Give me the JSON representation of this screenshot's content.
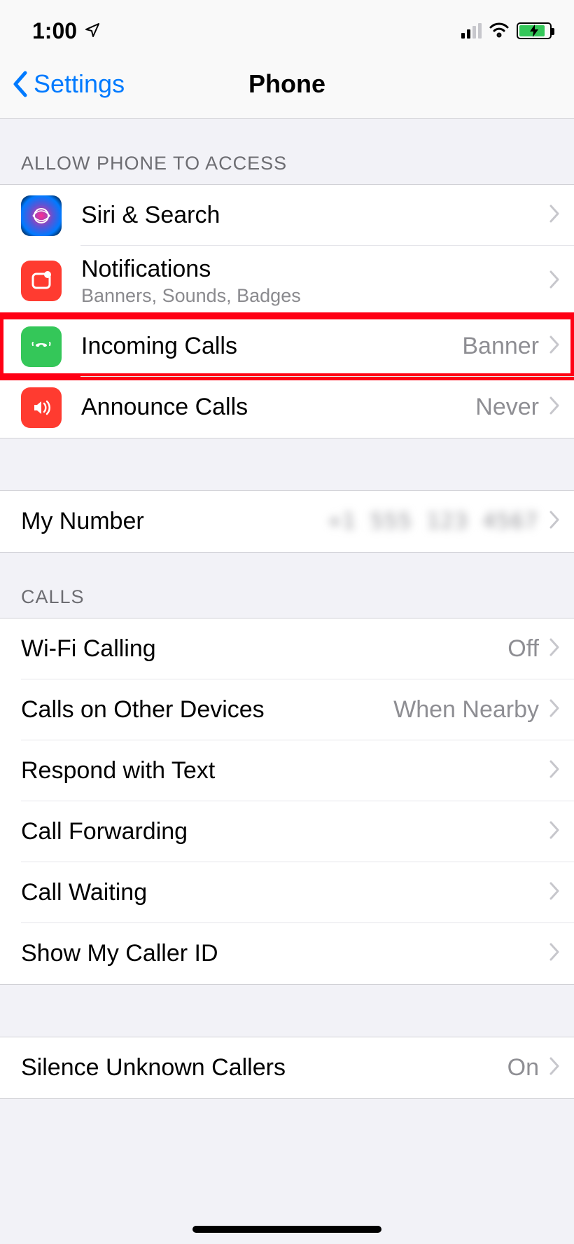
{
  "status": {
    "time": "1:00"
  },
  "nav": {
    "back": "Settings",
    "title": "Phone"
  },
  "section_access_header": "ALLOW PHONE TO ACCESS",
  "access": {
    "siri": {
      "title": "Siri & Search"
    },
    "notif": {
      "title": "Notifications",
      "sub": "Banners, Sounds, Badges"
    },
    "incoming": {
      "title": "Incoming Calls",
      "value": "Banner"
    },
    "announce": {
      "title": "Announce Calls",
      "value": "Never"
    }
  },
  "mynumber": {
    "title": "My Number",
    "value": "+1 555 123 4567"
  },
  "section_calls_header": "CALLS",
  "calls": {
    "wifi": {
      "title": "Wi-Fi Calling",
      "value": "Off"
    },
    "otherdev": {
      "title": "Calls on Other Devices",
      "value": "When Nearby"
    },
    "respond": {
      "title": "Respond with Text"
    },
    "forward": {
      "title": "Call Forwarding"
    },
    "waiting": {
      "title": "Call Waiting"
    },
    "callerid": {
      "title": "Show My Caller ID"
    }
  },
  "silence": {
    "title": "Silence Unknown Callers",
    "value": "On"
  }
}
